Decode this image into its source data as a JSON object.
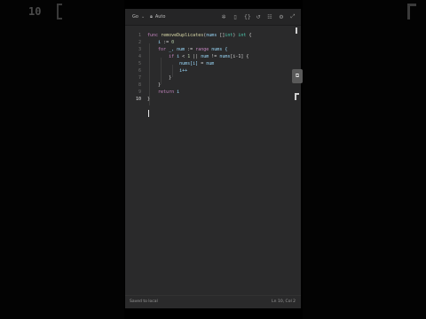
{
  "background": {
    "ghost_number": "10"
  },
  "toolbar": {
    "language": "Go",
    "mode": "Auto",
    "icons": [
      "bug-icon",
      "bookmark-icon",
      "braces-icon",
      "undo-icon",
      "settings-sliders-icon",
      "gear-icon",
      "expand-icon"
    ]
  },
  "editor": {
    "line_numbers": [
      "1",
      "2",
      "3",
      "4",
      "5",
      "6",
      "7",
      "8",
      "9",
      "10"
    ],
    "active_line": "10",
    "lines": [
      [
        {
          "t": "func ",
          "c": "kw"
        },
        {
          "t": "removeDuplicates",
          "c": "fn"
        },
        {
          "t": "(",
          "c": "op"
        },
        {
          "t": "nums ",
          "c": "vr"
        },
        {
          "t": "[]",
          "c": "op"
        },
        {
          "t": "int",
          "c": "ty"
        },
        {
          "t": ") ",
          "c": "op"
        },
        {
          "t": "int",
          "c": "ty"
        },
        {
          "t": " {",
          "c": "op"
        }
      ],
      [
        {
          "t": "    i ",
          "c": "vr"
        },
        {
          "t": ":= ",
          "c": "op"
        },
        {
          "t": "0",
          "c": "nm"
        }
      ],
      [
        {
          "t": "    for ",
          "c": "kw"
        },
        {
          "t": "_, num ",
          "c": "vr"
        },
        {
          "t": ":= ",
          "c": "op"
        },
        {
          "t": "range ",
          "c": "kw"
        },
        {
          "t": "nums {",
          "c": "vr"
        }
      ],
      [
        {
          "t": "        if ",
          "c": "kw"
        },
        {
          "t": "i ",
          "c": "vr"
        },
        {
          "t": "< ",
          "c": "op"
        },
        {
          "t": "1 ",
          "c": "nm"
        },
        {
          "t": "|| ",
          "c": "op"
        },
        {
          "t": "num ",
          "c": "vr"
        },
        {
          "t": "!= ",
          "c": "op"
        },
        {
          "t": "nums",
          "c": "vr"
        },
        {
          "t": "[i-1] {",
          "c": "op"
        }
      ],
      [
        {
          "t": "            nums[i] ",
          "c": "vr"
        },
        {
          "t": "= ",
          "c": "op"
        },
        {
          "t": "num",
          "c": "vr"
        }
      ],
      [
        {
          "t": "            i++",
          "c": "vr"
        }
      ],
      [
        {
          "t": "        }",
          "c": "op"
        }
      ],
      [
        {
          "t": "    }",
          "c": "op"
        }
      ],
      [
        {
          "t": "    return ",
          "c": "kw"
        },
        {
          "t": "i",
          "c": "vr"
        }
      ],
      [
        {
          "t": "}",
          "c": "op"
        }
      ]
    ]
  },
  "side_button": {
    "label": "⧉"
  },
  "status": {
    "left": "Saved to local",
    "right": "Ln 10, Col 2"
  }
}
